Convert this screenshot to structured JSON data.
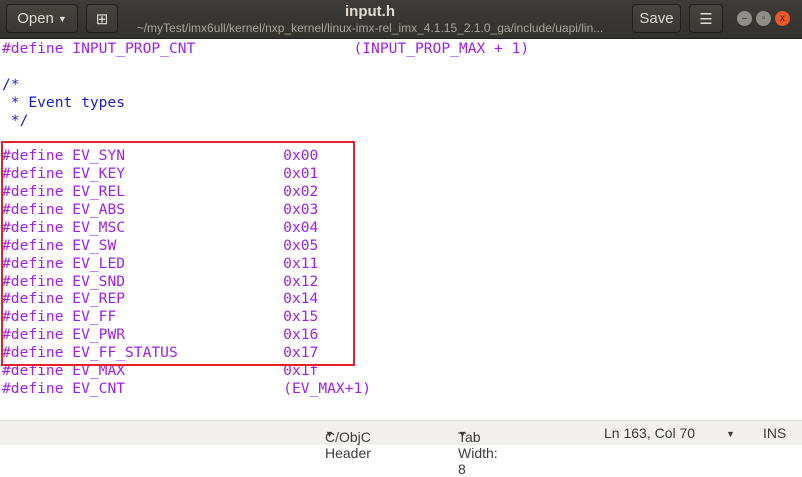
{
  "header": {
    "open_label": "Open",
    "title": "input.h",
    "path": "~/myTest/imx6ull/kernel/nxp_kernel/linux-imx-rel_imx_4.1.15_2.1.0_ga/include/uapi/lin...",
    "save_label": "Save"
  },
  "code": [
    {
      "kind": "define",
      "name": "INPUT_PROP_CNT",
      "value": "(INPUT_PROP_MAX + 1)",
      "pad": 40
    },
    {
      "kind": "blank",
      "text": ""
    },
    {
      "kind": "comment",
      "text": "/*"
    },
    {
      "kind": "comment",
      "text": " * Event types"
    },
    {
      "kind": "comment",
      "text": " */"
    },
    {
      "kind": "blank",
      "text": ""
    },
    {
      "kind": "define",
      "name": "EV_SYN",
      "value": "0x00",
      "pad": 32
    },
    {
      "kind": "define",
      "name": "EV_KEY",
      "value": "0x01",
      "pad": 32
    },
    {
      "kind": "define",
      "name": "EV_REL",
      "value": "0x02",
      "pad": 32
    },
    {
      "kind": "define",
      "name": "EV_ABS",
      "value": "0x03",
      "pad": 32
    },
    {
      "kind": "define",
      "name": "EV_MSC",
      "value": "0x04",
      "pad": 32
    },
    {
      "kind": "define",
      "name": "EV_SW",
      "value": "0x05",
      "pad": 32
    },
    {
      "kind": "define",
      "name": "EV_LED",
      "value": "0x11",
      "pad": 32
    },
    {
      "kind": "define",
      "name": "EV_SND",
      "value": "0x12",
      "pad": 32
    },
    {
      "kind": "define",
      "name": "EV_REP",
      "value": "0x14",
      "pad": 32
    },
    {
      "kind": "define",
      "name": "EV_FF",
      "value": "0x15",
      "pad": 32
    },
    {
      "kind": "define",
      "name": "EV_PWR",
      "value": "0x16",
      "pad": 32
    },
    {
      "kind": "define",
      "name": "EV_FF_STATUS",
      "value": "0x17",
      "pad": 32
    },
    {
      "kind": "define",
      "name": "EV_MAX",
      "value": "0x1f",
      "pad": 32
    },
    {
      "kind": "define",
      "name": "EV_CNT",
      "value": "(EV_MAX+1)",
      "pad": 32
    }
  ],
  "status": {
    "language": "C/ObjC Header",
    "tab_width": "Tab Width: 8",
    "position": "Ln 163, Col 70",
    "mode": "INS"
  },
  "colors": {
    "preprocessor": "#a020f0",
    "comment": "#1a1ad8",
    "highlight_box": "#e8202a"
  }
}
